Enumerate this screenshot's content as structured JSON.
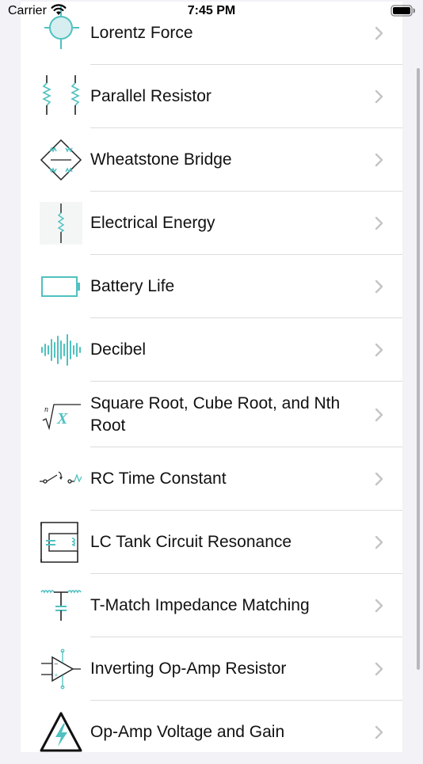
{
  "status_bar": {
    "carrier": "Carrier",
    "time": "7:45 PM"
  },
  "accent_color": "#4fc1c0",
  "list": [
    {
      "label": "Lorentz Force",
      "icon": "lorentz-force-icon"
    },
    {
      "label": "Parallel Resistor",
      "icon": "parallel-resistor-icon"
    },
    {
      "label": "Wheatstone Bridge",
      "icon": "wheatstone-bridge-icon"
    },
    {
      "label": "Electrical Energy",
      "icon": "electrical-energy-icon"
    },
    {
      "label": "Battery Life",
      "icon": "battery-life-icon"
    },
    {
      "label": "Decibel",
      "icon": "decibel-waveform-icon"
    },
    {
      "label": "Square Root, Cube Root, and Nth Root",
      "icon": "nth-root-icon"
    },
    {
      "label": "RC Time Constant",
      "icon": "rc-switch-icon"
    },
    {
      "label": "LC Tank Circuit Resonance",
      "icon": "lc-tank-circuit-icon"
    },
    {
      "label": "T-Match Impedance Matching",
      "icon": "t-match-icon"
    },
    {
      "label": "Inverting Op-Amp Resistor",
      "icon": "op-amp-icon"
    },
    {
      "label": "Op-Amp Voltage and Gain",
      "icon": "high-voltage-warning-icon"
    }
  ]
}
